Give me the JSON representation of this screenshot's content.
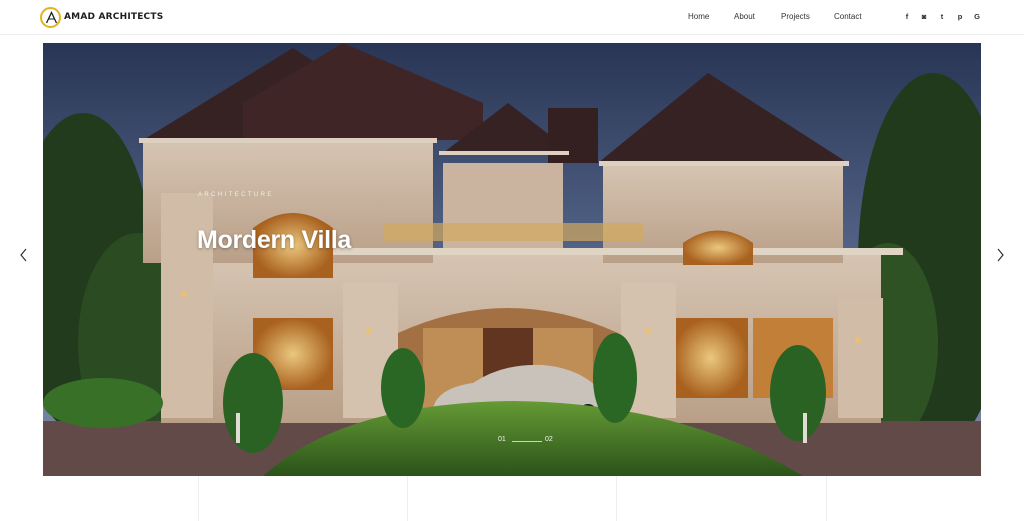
{
  "brand": {
    "name": "AMAD ARCHITECTS",
    "accent": "#e2b31b"
  },
  "nav": {
    "items": [
      {
        "label": "Home"
      },
      {
        "label": "About"
      },
      {
        "label": "Projects"
      },
      {
        "label": "Contact"
      }
    ]
  },
  "social": {
    "icons": [
      {
        "name": "facebook-icon",
        "glyph": "f"
      },
      {
        "name": "instagram-icon",
        "glyph": "◙"
      },
      {
        "name": "twitter-icon",
        "glyph": "t"
      },
      {
        "name": "pinterest-icon",
        "glyph": "p"
      },
      {
        "name": "google-icon",
        "glyph": "G"
      }
    ]
  },
  "hero": {
    "kicker": "ARCHITECTURE",
    "title": "Mordern Villa",
    "slide_current": "01",
    "slide_total": "02",
    "image": "two-storey villa with dark hip roofs at dusk"
  },
  "controls": {
    "prev_icon": "chevron-left-icon",
    "next_icon": "chevron-right-icon"
  }
}
